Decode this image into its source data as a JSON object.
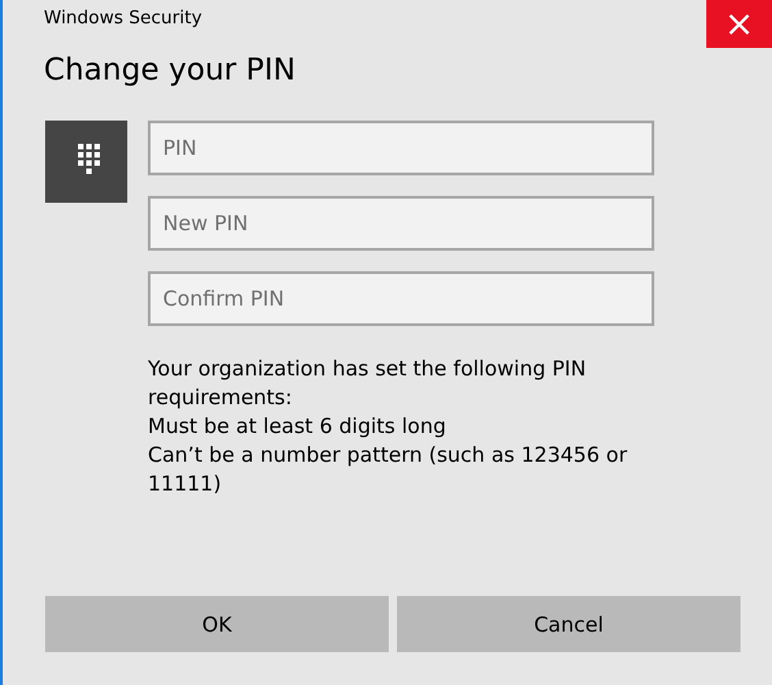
{
  "window": {
    "title": "Windows Security",
    "close": "×"
  },
  "heading": "Change your PIN",
  "fields": [
    {
      "placeholder": "PIN"
    },
    {
      "placeholder": "New PIN"
    },
    {
      "placeholder": "Confirm PIN"
    }
  ],
  "requirements": [
    "Your organization has set the following PIN requirements:",
    "Must be at least 6 digits long",
    "Can’t be a number pattern (such as 123456 or 11111)"
  ],
  "buttons": [
    "OK",
    "Cancel"
  ]
}
